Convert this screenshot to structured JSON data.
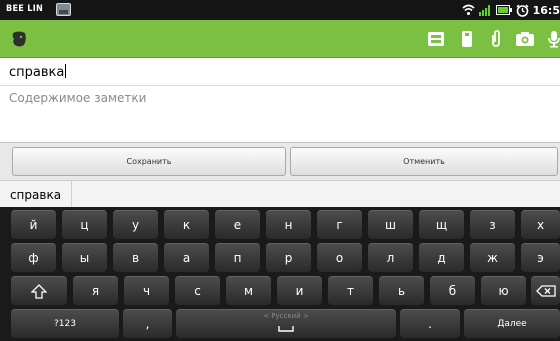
{
  "status_bar": {
    "carrier": "BEE LIN",
    "time": "16:5"
  },
  "colors": {
    "app_bar": "#7ac043",
    "status_bar": "#151515",
    "keyboard": "#1a1a1a"
  },
  "app_bar": {
    "logo_icon": "evernote-elephant-icon",
    "actions": [
      "save-note-icon",
      "audio-note-icon",
      "attach-icon",
      "camera-icon",
      "microphone-icon"
    ]
  },
  "note": {
    "title_value": "справка",
    "content_placeholder": "Содержимое заметки"
  },
  "buttons": {
    "save": "Сохранить",
    "cancel": "Отменить"
  },
  "suggestion": "справка",
  "keyboard": {
    "row1": [
      "й",
      "ц",
      "у",
      "к",
      "е",
      "н",
      "г",
      "ш",
      "щ",
      "з",
      "х"
    ],
    "row2": [
      "ф",
      "ы",
      "в",
      "а",
      "п",
      "р",
      "о",
      "л",
      "д",
      "ж",
      "э"
    ],
    "row3": [
      "я",
      "ч",
      "с",
      "м",
      "и",
      "т",
      "ь",
      "б",
      "ю"
    ],
    "symbols": "?123",
    "comma": ",",
    "space_hint": "< Русский >",
    "period": ".",
    "enter": "Далее"
  }
}
